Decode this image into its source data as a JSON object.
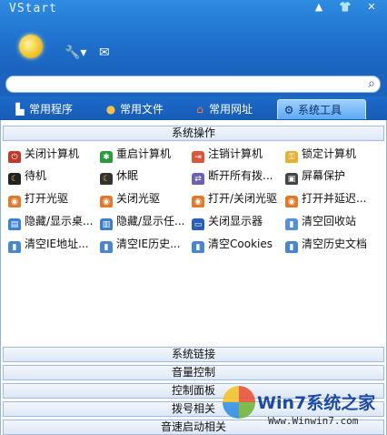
{
  "window": {
    "title": "VStart",
    "buttons": [
      "▲",
      "👕",
      "✕"
    ]
  },
  "toolbar": {
    "sun_icon": "sun-icon",
    "wrench": "🔧▾",
    "mail": "✉"
  },
  "search": {
    "placeholder": "",
    "icon": "⌕"
  },
  "tabs": [
    {
      "label": "常用程序",
      "icon": "▙"
    },
    {
      "label": "常用文件",
      "icon": "●"
    },
    {
      "label": "常用网址",
      "icon": "⌂"
    },
    {
      "label": "系统工具",
      "icon": "⚙"
    }
  ],
  "sections": {
    "system_ops": "系统操作",
    "system_links": "系统链接",
    "volume": "音量控制",
    "control_panel": "控制面板",
    "dialup": "拨号相关",
    "speedup": "音速启动相关"
  },
  "items": {
    "r1": [
      "关闭计算机",
      "重启计算机",
      "注销计算机",
      "锁定计算机"
    ],
    "r2": [
      "待机",
      "休眠",
      "断开所有拨...",
      "屏幕保护"
    ],
    "r3": [
      "打开光驱",
      "关闭光驱",
      "打开/关闭光驱",
      "打开并延迟..."
    ],
    "r4": [
      "隐藏/显示桌...",
      "隐藏/显示任...",
      "关闭显示器",
      "清空回收站"
    ],
    "r5": [
      "清空IE地址...",
      "清空IE历史...",
      "清空Cookies",
      "清空历史文档"
    ]
  },
  "watermark": {
    "text": "Win7系统之家",
    "url": "Www.Winwin7.com"
  }
}
